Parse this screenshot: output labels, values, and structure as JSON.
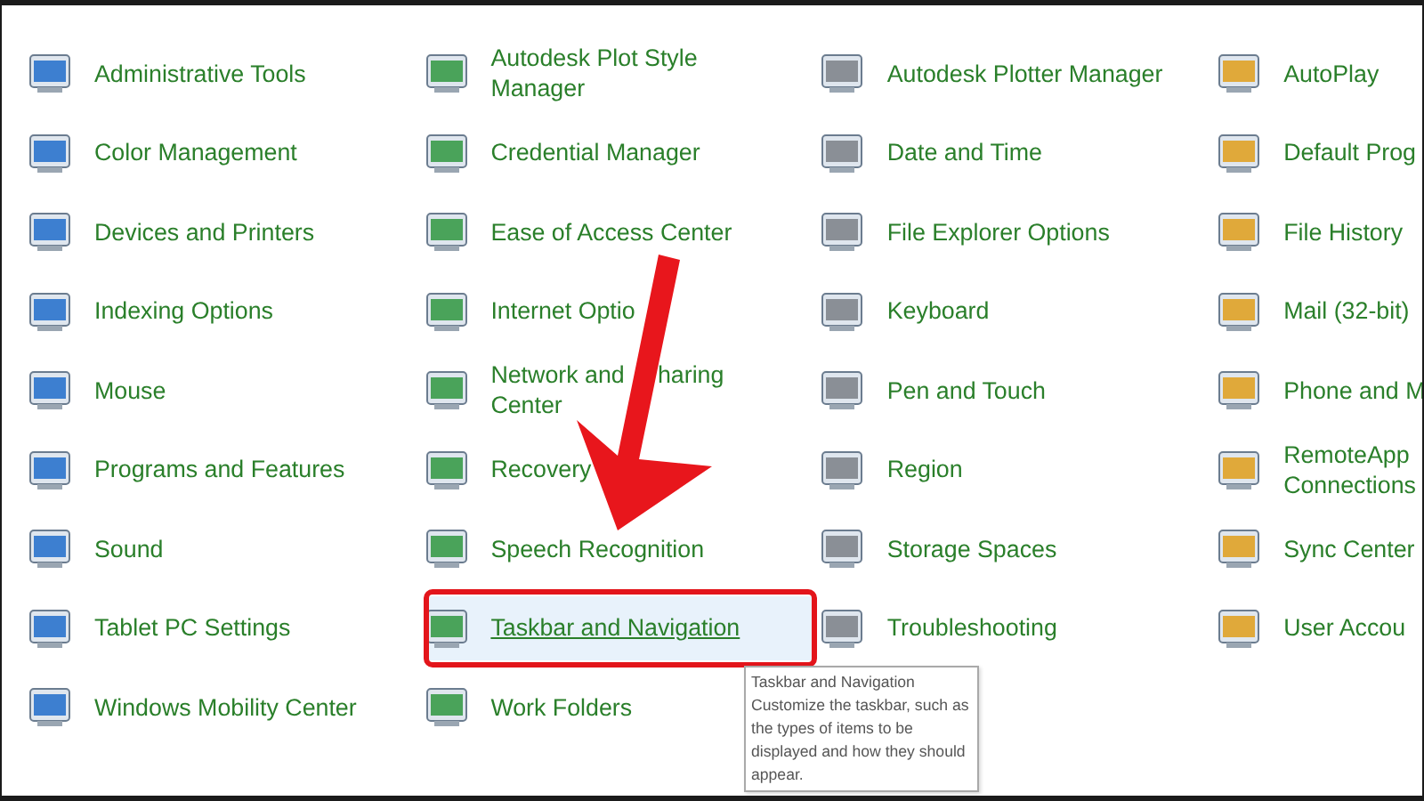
{
  "columns": [
    {
      "items": [
        {
          "label": "Administrative Tools",
          "selected": false
        },
        {
          "label": "Color Management",
          "selected": false
        },
        {
          "label": "Devices and Printers",
          "selected": false
        },
        {
          "label": "Indexing Options",
          "selected": false
        },
        {
          "label": "Mouse",
          "selected": false
        },
        {
          "label": "Programs and Features",
          "selected": false
        },
        {
          "label": "Sound",
          "selected": false
        },
        {
          "label": "Tablet PC Settings",
          "selected": false
        },
        {
          "label": "Windows Mobility Center",
          "selected": false
        }
      ]
    },
    {
      "items": [
        {
          "label": "Autodesk Plot Style\nManager",
          "selected": false
        },
        {
          "label": "Credential Manager",
          "selected": false
        },
        {
          "label": "Ease of Access Center",
          "selected": false
        },
        {
          "label": "Internet Optio",
          "selected": false
        },
        {
          "label": "Network and     haring\nCenter",
          "selected": false
        },
        {
          "label": "Recovery",
          "selected": false
        },
        {
          "label": "Speech Recognition",
          "selected": false
        },
        {
          "label": "Taskbar and Navigation",
          "selected": true
        },
        {
          "label": "Work Folders",
          "selected": false
        }
      ]
    },
    {
      "items": [
        {
          "label": "Autodesk Plotter Manager",
          "selected": false
        },
        {
          "label": "Date and Time",
          "selected": false
        },
        {
          "label": "File Explorer Options",
          "selected": false
        },
        {
          "label": "Keyboard",
          "selected": false
        },
        {
          "label": "Pen and Touch",
          "selected": false
        },
        {
          "label": "Region",
          "selected": false
        },
        {
          "label": "Storage Spaces",
          "selected": false
        },
        {
          "label": "Troubleshooting",
          "selected": false
        }
      ]
    },
    {
      "items": [
        {
          "label": "AutoPlay",
          "selected": false
        },
        {
          "label": "Default Prog",
          "selected": false
        },
        {
          "label": "File History",
          "selected": false
        },
        {
          "label": "Mail (32-bit)",
          "selected": false
        },
        {
          "label": "Phone and M",
          "selected": false
        },
        {
          "label": "RemoteApp\nConnections",
          "selected": false
        },
        {
          "label": "Sync Center",
          "selected": false
        },
        {
          "label": "User Accou",
          "selected": false
        }
      ]
    }
  ],
  "tooltip": {
    "title": "Taskbar and Navigation",
    "text": "Customize the taskbar, such as the types of items to be displayed and how they should appear."
  }
}
